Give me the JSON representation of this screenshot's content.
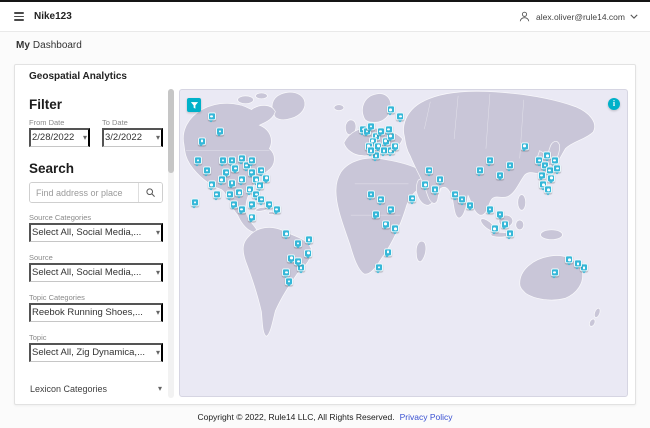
{
  "colors": {
    "accent": "#00b1c9",
    "marker": "#35b7d8",
    "link": "#3950d2",
    "ocean": "#eae9f4",
    "land": "#c9c6d8"
  },
  "chars": {
    "caret": "▾",
    "info": "i"
  },
  "header": {
    "brand": "Nike123",
    "user_email": "alex.oliver@rule14.com"
  },
  "breadcrumb": {
    "section": "My",
    "page": "Dashboard"
  },
  "panel": {
    "title": "Geospatial Analytics"
  },
  "sidebar": {
    "filter_heading": "Filter",
    "from": {
      "label": "From Date",
      "value": "2/28/2022"
    },
    "to": {
      "label": "To Date",
      "value": "3/2/2022"
    },
    "search_heading": "Search",
    "search_placeholder": "Find address or place",
    "fields": [
      {
        "label": "Source Categories",
        "value": "Select All, Social Media,..."
      },
      {
        "label": "Source",
        "value": "Select All, Social Media,..."
      },
      {
        "label": "Topic Categories",
        "value": "Reebok Running Shoes,..."
      },
      {
        "label": "Topic",
        "value": "Select All, Zig Dynamica,..."
      }
    ],
    "lexicon_label": "Lexicon Categories"
  },
  "footer": {
    "copyright": "Copyright © 2022, Rule14 LLC, All Rights Reserved.",
    "privacy_label": "Privacy Policy"
  },
  "map": {
    "markers": [
      [
        7.1,
        9.2
      ],
      [
        8.9,
        14
      ],
      [
        4.9,
        17.2
      ],
      [
        4,
        23.6
      ],
      [
        6,
        26.8
      ],
      [
        7.1,
        31.5
      ],
      [
        9.6,
        23.6
      ],
      [
        10.4,
        27.4
      ],
      [
        11.6,
        23.6
      ],
      [
        12.4,
        26.1
      ],
      [
        13.8,
        22.9
      ],
      [
        14.9,
        25.2
      ],
      [
        16,
        27.4
      ],
      [
        17.1,
        29.9
      ],
      [
        17.8,
        31.8
      ],
      [
        13.8,
        29.9
      ],
      [
        11.6,
        30.9
      ],
      [
        9.3,
        29.9
      ],
      [
        16,
        23.6
      ],
      [
        18.2,
        26.8
      ],
      [
        19.3,
        29.3
      ],
      [
        15.6,
        33.1
      ],
      [
        17.1,
        34.7
      ],
      [
        13.3,
        34.1
      ],
      [
        11.1,
        34.7
      ],
      [
        8.2,
        34.7
      ],
      [
        12,
        37.9
      ],
      [
        13.8,
        39.5
      ],
      [
        16,
        37.9
      ],
      [
        18.2,
        36.3
      ],
      [
        20,
        37.9
      ],
      [
        21.6,
        39.5
      ],
      [
        16,
        42
      ],
      [
        3.3,
        37.3
      ],
      [
        23.8,
        47.5
      ],
      [
        26.4,
        50.6
      ],
      [
        28.7,
        53.8
      ],
      [
        24.9,
        55.4
      ],
      [
        27.1,
        58.6
      ],
      [
        26.5,
        56.5
      ],
      [
        23.8,
        60.2
      ],
      [
        24.4,
        63
      ],
      [
        28.9,
        49.5
      ],
      [
        40.9,
        13.4
      ],
      [
        41.8,
        14
      ],
      [
        42.7,
        12.4
      ],
      [
        43.8,
        15.6
      ],
      [
        44.9,
        14
      ],
      [
        43.1,
        17.2
      ],
      [
        42.2,
        18.8
      ],
      [
        44.4,
        18.8
      ],
      [
        46,
        17.2
      ],
      [
        47.1,
        15.6
      ],
      [
        45.6,
        20.4
      ],
      [
        43.8,
        22
      ],
      [
        47.1,
        20.4
      ],
      [
        48.2,
        18.8
      ],
      [
        46.7,
        13.4
      ],
      [
        42.7,
        20.4
      ],
      [
        47.1,
        7
      ],
      [
        49.3,
        9.2
      ],
      [
        42.7,
        34.7
      ],
      [
        44.9,
        36.3
      ],
      [
        47.1,
        39.5
      ],
      [
        43.8,
        41.1
      ],
      [
        46,
        44.3
      ],
      [
        48.2,
        45.9
      ],
      [
        52,
        36
      ],
      [
        44.5,
        58.5
      ],
      [
        46.5,
        53.5
      ],
      [
        54.9,
        31.5
      ],
      [
        57.1,
        33.1
      ],
      [
        58.2,
        29.9
      ],
      [
        55.8,
        26.8
      ],
      [
        61.6,
        34.7
      ],
      [
        63.1,
        36.3
      ],
      [
        64.9,
        38.2
      ],
      [
        69.3,
        39.5
      ],
      [
        71.6,
        41.1
      ],
      [
        72.7,
        44.3
      ],
      [
        70.4,
        45.9
      ],
      [
        73.8,
        47.5
      ],
      [
        67.1,
        26.8
      ],
      [
        69.3,
        23.6
      ],
      [
        71.6,
        28.4
      ],
      [
        73.8,
        25.2
      ],
      [
        80.4,
        23.6
      ],
      [
        81.6,
        25.2
      ],
      [
        82.7,
        26.8
      ],
      [
        83.8,
        23.6
      ],
      [
        82.2,
        22
      ],
      [
        80.9,
        28.4
      ],
      [
        83.1,
        29.3
      ],
      [
        84.4,
        26.2
      ],
      [
        81.3,
        31.5
      ],
      [
        82.4,
        33.1
      ],
      [
        77.1,
        18.8
      ],
      [
        83.8,
        60.2
      ],
      [
        87.1,
        56
      ],
      [
        90.4,
        58.6
      ],
      [
        89,
        57.3
      ]
    ]
  }
}
